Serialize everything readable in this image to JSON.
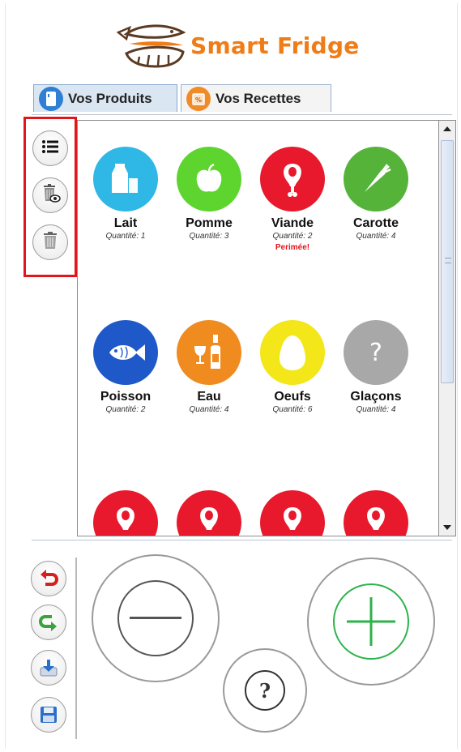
{
  "app": {
    "title": "Smart Fridge",
    "brand_color": "#f07c18"
  },
  "tabs": [
    {
      "label": "Vos Produits",
      "icon": "fridge-icon",
      "active": true
    },
    {
      "label": "Vos Recettes",
      "icon": "recipe-icon",
      "active": false
    }
  ],
  "side_tools": [
    {
      "icon": "list-icon"
    },
    {
      "icon": "trash-eye-icon"
    },
    {
      "icon": "trash-icon"
    }
  ],
  "products": [
    {
      "name": "Lait",
      "qty": "Quantité: 1",
      "color": "#2fb7e6",
      "icon": "milk-icon",
      "expired": ""
    },
    {
      "name": "Pomme",
      "qty": "Quantité: 3",
      "color": "#5ed42f",
      "icon": "apple-icon",
      "expired": ""
    },
    {
      "name": "Viande",
      "qty": "Quantité: 2",
      "color": "#e8192c",
      "icon": "ham-icon",
      "expired": "Perimée!"
    },
    {
      "name": "Carotte",
      "qty": "Quantité: 4",
      "color": "#55b33a",
      "icon": "carrot-icon",
      "expired": ""
    },
    {
      "name": "Poisson",
      "qty": "Quantité: 2",
      "color": "#1f59c9",
      "icon": "fish-icon",
      "expired": ""
    },
    {
      "name": "Eau",
      "qty": "Quantité: 4",
      "color": "#f08b1f",
      "icon": "drinks-icon",
      "expired": ""
    },
    {
      "name": "Oeufs",
      "qty": "Quantité: 6",
      "color": "#f3e619",
      "icon": "egg-icon",
      "expired": ""
    },
    {
      "name": "Glaçons",
      "qty": "Quantité: 4",
      "color": "#a8a8a8",
      "icon": "question-icon",
      "expired": ""
    }
  ],
  "more_products_icon": "ham-icon",
  "help_label": "?",
  "bottom_tools": [
    {
      "icon": "undo-icon",
      "color": "#d42020"
    },
    {
      "icon": "redo-icon",
      "color": "#3aa33a"
    },
    {
      "icon": "import-icon",
      "color": "#2a6fc8"
    },
    {
      "icon": "save-icon",
      "color": "#2a6fc8"
    }
  ],
  "controls": {
    "minus_color": "#555555",
    "plus_color": "#2db34a"
  }
}
